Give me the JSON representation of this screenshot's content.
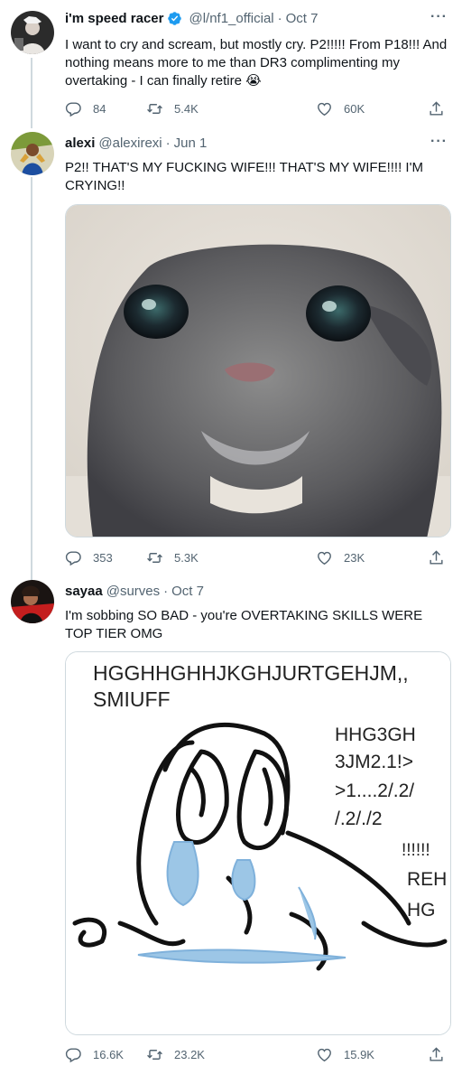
{
  "tweets": [
    {
      "display_name": "i'm speed racer",
      "verified": true,
      "handle": "@l/nf1_official",
      "date": "Oct 7",
      "text": "I want to cry and scream, but mostly cry. P2!!!!! From P18!!! And nothing means more to me than DR3 complimenting my overtaking - I can finally retire 😭",
      "replies": "84",
      "retweets": "5.4K",
      "likes": "60K"
    },
    {
      "display_name": "alexi",
      "verified": false,
      "handle": "@alexirexi",
      "date": "Jun 1",
      "text": "P2!! THAT'S MY FUCKING WIFE!!! THAT'S MY WIFE!!!! I'M CRYING!!",
      "replies": "353",
      "retweets": "5.3K",
      "likes": "23K"
    },
    {
      "display_name": "sayaa",
      "verified": false,
      "handle": "@surves",
      "date": "Oct 7",
      "text": "I'm sobbing SO BAD - you're OVERTAKING SKILLS WERE TOP TIER OMG",
      "replies": "16.6K",
      "retweets": "23.2K",
      "likes": "15.9K"
    }
  ],
  "meme": {
    "line1": "HGGHHGHHJKGHJURTGEHJM,,",
    "line2": "SMIUFF",
    "right_lines": [
      "HHG3GH",
      "3JM2.1!>",
      ">1....2/.2/",
      "/.2/./2"
    ],
    "exclaim": "!!!!!!",
    "reh": "REH",
    "hg": "HG"
  },
  "icons": {
    "more": "more-dots-icon",
    "reply": "reply-icon",
    "retweet": "retweet-icon",
    "like": "heart-icon",
    "share": "share-icon",
    "verified": "verified-badge-icon"
  },
  "colors": {
    "text": "#0f1419",
    "secondary": "#536471",
    "verified": "#1d9bf0",
    "thread_line": "#cfd9de",
    "border": "#cfd9de"
  }
}
